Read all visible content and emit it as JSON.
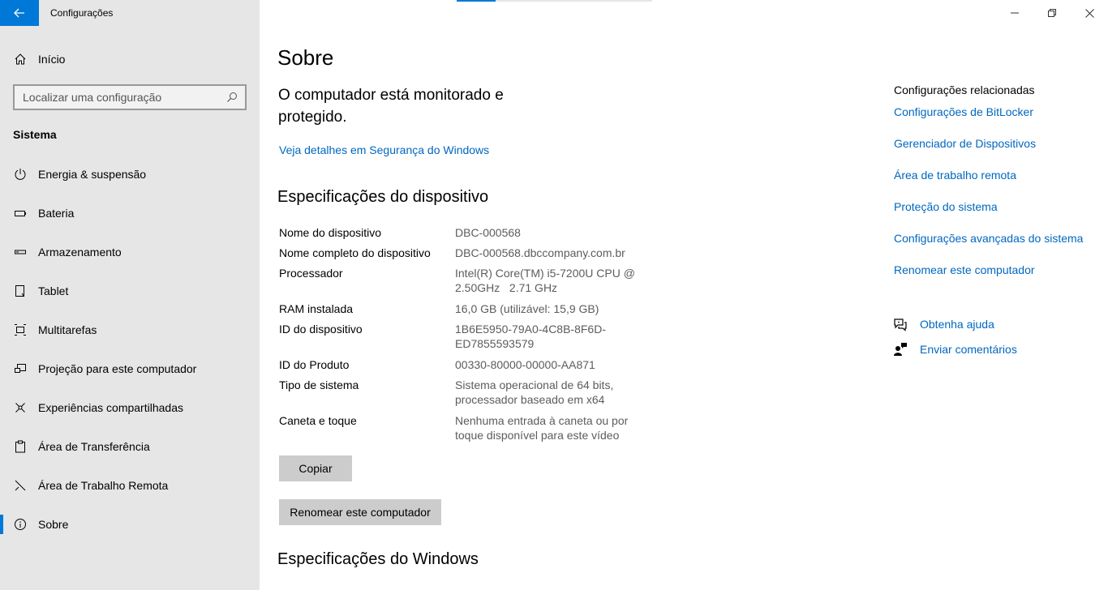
{
  "window": {
    "app_title": "Configurações"
  },
  "sidebar": {
    "home_label": "Início",
    "search_placeholder": "Localizar uma configuração",
    "section_title": "Sistema",
    "items": [
      {
        "label": "Energia & suspensão",
        "icon": "power-icon"
      },
      {
        "label": "Bateria",
        "icon": "battery-icon"
      },
      {
        "label": "Armazenamento",
        "icon": "storage-icon"
      },
      {
        "label": "Tablet",
        "icon": "tablet-icon"
      },
      {
        "label": "Multitarefas",
        "icon": "multitasking-icon"
      },
      {
        "label": "Projeção para este computador",
        "icon": "projection-icon"
      },
      {
        "label": "Experiências compartilhadas",
        "icon": "shared-experiences-icon"
      },
      {
        "label": "Área de Transferência",
        "icon": "clipboard-icon"
      },
      {
        "label": "Área de Trabalho Remota",
        "icon": "remote-desktop-icon"
      },
      {
        "label": "Sobre",
        "icon": "info-icon",
        "active": true
      }
    ]
  },
  "main": {
    "title": "Sobre",
    "status": "O computador está monitorado e protegido.",
    "security_link": "Veja detalhes em Segurança do Windows",
    "device_specs_title": "Especificações do dispositivo",
    "specs": [
      {
        "key": "Nome do dispositivo",
        "value": "DBC-000568"
      },
      {
        "key": "Nome completo do dispositivo",
        "value": "DBC-000568.dbccompany.com.br"
      },
      {
        "key": "Processador",
        "value": "Intel(R) Core(TM) i5-7200U CPU @ 2.50GHz   2.71 GHz"
      },
      {
        "key": "RAM instalada",
        "value": "16,0 GB (utilizável: 15,9 GB)"
      },
      {
        "key": "ID do dispositivo",
        "value": "1B6E5950-79A0-4C8B-8F6D-ED7855593579"
      },
      {
        "key": "ID do Produto",
        "value": "00330-80000-00000-AA871"
      },
      {
        "key": "Tipo de sistema",
        "value": "Sistema operacional de 64 bits, processador baseado em x64"
      },
      {
        "key": "Caneta e toque",
        "value": "Nenhuma entrada à caneta ou por toque disponível para este vídeo"
      }
    ],
    "copy_button": "Copiar",
    "rename_button": "Renomear este computador",
    "windows_specs_title": "Especificações do Windows"
  },
  "related": {
    "title": "Configurações relacionadas",
    "links": [
      "Configurações de BitLocker",
      "Gerenciador de Dispositivos",
      "Área de trabalho remota",
      "Proteção do sistema",
      "Configurações avançadas do sistema",
      "Renomear este computador"
    ],
    "help": "Obtenha ajuda",
    "feedback": "Enviar comentários"
  },
  "colors": {
    "accent": "#0078d7",
    "link": "#0067c0",
    "sidebar_bg": "#e6e6e6"
  }
}
